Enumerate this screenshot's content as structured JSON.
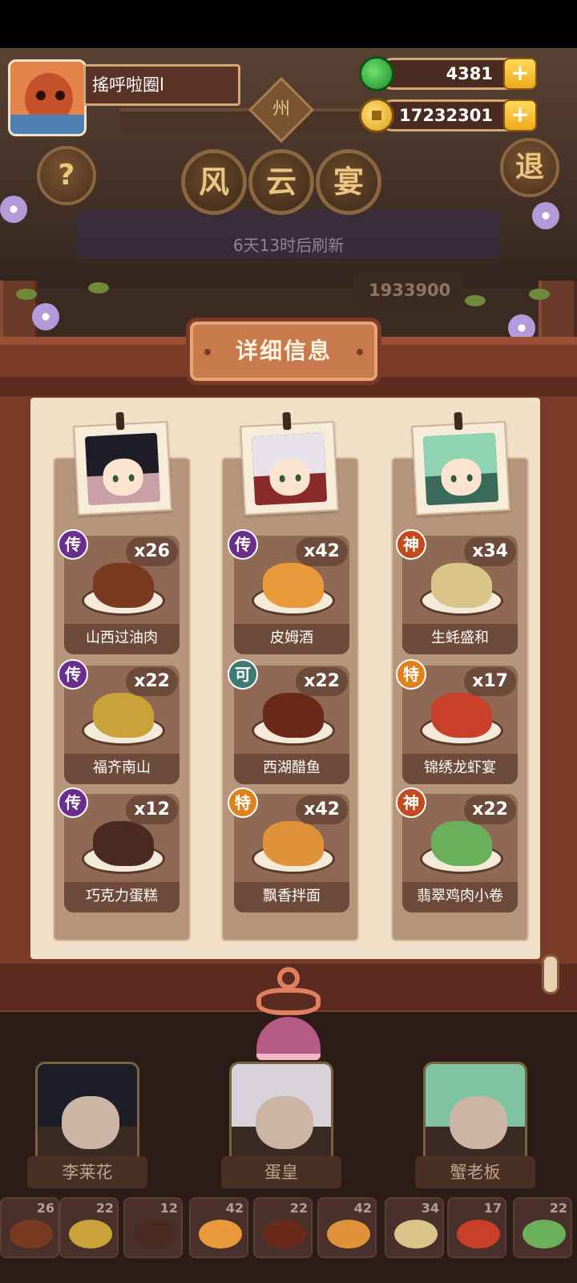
{
  "player": {
    "name": "搖呼啦圈l"
  },
  "resources": {
    "jade": "4381",
    "coins": "17232301",
    "plus": "+"
  },
  "header": {
    "region_tag": "州",
    "title_chars": [
      "风",
      "云",
      "宴"
    ],
    "refresh_text": "6天13时后刷新",
    "score_partial": "1933900",
    "help_label": "?",
    "exit_label": "退"
  },
  "detail": {
    "title": "详细信息",
    "columns": [
      {
        "portrait_colors": {
          "hair": "#1d1d28",
          "accent": "#c24a6a"
        },
        "dishes": [
          {
            "name": "山西过油肉",
            "count": "x26",
            "rarity": "传",
            "rarity_class": "r-chuan",
            "food": "#7a3a22"
          },
          {
            "name": "福齐南山",
            "count": "x22",
            "rarity": "传",
            "rarity_class": "r-chuan",
            "food": "#c9a23a"
          },
          {
            "name": "巧克力蛋糕",
            "count": "x12",
            "rarity": "传",
            "rarity_class": "r-chuan",
            "food": "#4a2a20"
          }
        ]
      },
      {
        "portrait_colors": {
          "hair": "#e8e3ea",
          "accent": "#c8373a"
        },
        "dishes": [
          {
            "name": "皮姆酒",
            "count": "x42",
            "rarity": "传",
            "rarity_class": "r-chuan",
            "food": "#e89a3a"
          },
          {
            "name": "西湖醋鱼",
            "count": "x22",
            "rarity": "可",
            "rarity_class": "r-ke",
            "food": "#6a2a1a"
          },
          {
            "name": "飘香拌面",
            "count": "x42",
            "rarity": "特",
            "rarity_class": "r-te",
            "food": "#e0923a"
          }
        ]
      },
      {
        "portrait_colors": {
          "hair": "#8fd4b2",
          "accent": "#d8b24a"
        },
        "dishes": [
          {
            "name": "生蚝盛和",
            "count": "x34",
            "rarity": "神",
            "rarity_class": "r-shen",
            "food": "#d9c48a"
          },
          {
            "name": "锦绣龙虾宴",
            "count": "x17",
            "rarity": "特",
            "rarity_class": "r-te",
            "food": "#c8402a"
          },
          {
            "name": "翡翠鸡肉小卷",
            "count": "x22",
            "rarity": "神",
            "rarity_class": "r-shen",
            "food": "#6ab05a"
          }
        ]
      }
    ]
  },
  "chefs": [
    {
      "name": "李莱花",
      "hair": "#1d1d28"
    },
    {
      "name": "蛋皇",
      "hair": "#d8d3da"
    },
    {
      "name": "蟹老板",
      "hair": "#7fc4a2"
    }
  ],
  "mini_dishes": [
    {
      "count": "26",
      "food": "#7a3a22"
    },
    {
      "count": "22",
      "food": "#c9a23a"
    },
    {
      "count": "12",
      "food": "#4a2a20"
    },
    {
      "count": "42",
      "food": "#e89a3a"
    },
    {
      "count": "22",
      "food": "#6a2a1a"
    },
    {
      "count": "42",
      "food": "#e0923a"
    },
    {
      "count": "34",
      "food": "#d9c48a"
    },
    {
      "count": "17",
      "food": "#c8402a"
    },
    {
      "count": "22",
      "food": "#6ab05a"
    }
  ]
}
